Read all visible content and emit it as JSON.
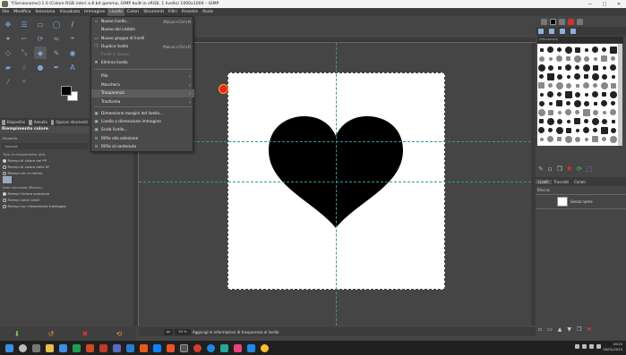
{
  "window": {
    "title": "*[Senzanome]-1.0 (Colore RGB interi a 8 bit gamma, GIMP built-in sRGB, 1 livello) 1000x1000 – GIMP",
    "controls": [
      "—",
      "□",
      "✕"
    ]
  },
  "menubar": [
    "File",
    "Modifica",
    "Seleziona",
    "Visualizza",
    "Immagine",
    "Livello",
    "Colori",
    "Strumenti",
    "Filtri",
    "Finestre",
    "Aiuto"
  ],
  "layer_menu": {
    "items": [
      {
        "label": "Nuovo livello...",
        "accel": "Maiusc+Ctrl+N",
        "icon": "new-layer-icon",
        "glyph": "▫"
      },
      {
        "label": "Nuovo dal visibile",
        "accel": "",
        "icon": "new-from-visible-icon",
        "glyph": ""
      },
      {
        "label": "Nuovo gruppo di livelli",
        "accel": "",
        "icon": "layer-group-icon",
        "glyph": "▭"
      },
      {
        "label": "Duplica livello",
        "accel": "Maiusc+Ctrl+D",
        "icon": "duplicate-icon",
        "glyph": "❐"
      },
      {
        "label": "Fondi in basso",
        "accel": "",
        "icon": "merge-down-icon",
        "glyph": "",
        "disabled": true
      },
      {
        "label": "Elimina livello",
        "accel": "",
        "icon": "delete-layer-icon",
        "glyph": "✖"
      },
      {
        "label": "Pila",
        "submenu": true,
        "icon": "stack-icon",
        "glyph": ""
      },
      {
        "label": "Maschera",
        "submenu": true,
        "icon": "mask-icon",
        "glyph": ""
      },
      {
        "label": "Trasparenza",
        "submenu": true,
        "highlighted": true,
        "icon": "transparency-icon",
        "glyph": ""
      },
      {
        "label": "Trasforma",
        "submenu": true,
        "icon": "transform-icon",
        "glyph": ""
      },
      {
        "label": "Dimensione margini del livello...",
        "accel": "",
        "icon": "boundary-size-icon",
        "glyph": "▣"
      },
      {
        "label": "Livello a dimensione immagine",
        "accel": "",
        "icon": "layer-to-image-icon",
        "glyph": "▣"
      },
      {
        "label": "Scala livello...",
        "accel": "",
        "icon": "scale-layer-icon",
        "glyph": "▣"
      },
      {
        "label": "Rifila alla selezione",
        "accel": "",
        "icon": "crop-to-selection-icon",
        "glyph": "⊡"
      },
      {
        "label": "Rifila al contenuto",
        "accel": "",
        "icon": "crop-to-content-icon",
        "glyph": "⊡"
      }
    ]
  },
  "toolbox": {
    "tabs": [
      "Dispositivi",
      "Annulla",
      "Opzioni strumenti"
    ],
    "tool_options": {
      "title": "Riempimento colore",
      "mode_label": "Modalità",
      "opacity_label": "Opacità",
      "fill_type_label": "Tipo di riempimento (Alt)",
      "fill_types": [
        "Riempi di colore del PP",
        "Riempi di colore dello SF",
        "Riempi con il motivo"
      ],
      "fill_type_selected": 0,
      "area_label": "Area coinvolta  (Maiusc)",
      "areas": [
        "Riempi l'intera selezione",
        "Riempi colori simili",
        "Riempi con rilevamento tratteggio"
      ],
      "area_selected": 0
    }
  },
  "status": {
    "unit": "px",
    "zoom": "50 %",
    "message": "Aggiungi le informazioni di trasparenza al livello"
  },
  "right_dock": {
    "filter_placeholder": "(filtrasesso)",
    "layers_tabs": [
      "Livelli",
      "Tracciati",
      "Canali"
    ],
    "lock_label": "Blocca:",
    "layer_name": "Senza nome"
  },
  "taskbar": {
    "time": "18:20",
    "date": "18/01/2023"
  },
  "colors": {
    "foreground": "#000000",
    "background": "#ffffff",
    "guide": "#2a9a9a"
  }
}
